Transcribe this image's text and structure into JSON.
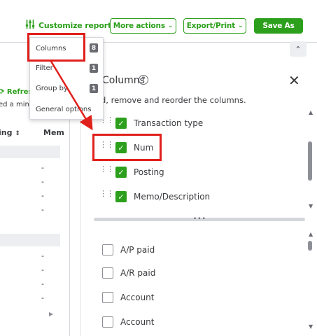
{
  "toolbar": {
    "customize_label": "Customize report",
    "more_actions_label": "More actions",
    "export_label": "Export/Print",
    "save_as_label": "Save As"
  },
  "report": {
    "refresh_label": "Refresh",
    "edited_text": "ed a min",
    "col1_header": "ing",
    "col2_header": "Mem",
    "dash": "-"
  },
  "menu": {
    "items": [
      {
        "label": "Columns",
        "badge": "8"
      },
      {
        "label": "Filter",
        "badge": "1"
      },
      {
        "label": "Group by",
        "badge": "1"
      },
      {
        "label": "General options",
        "badge": ""
      }
    ]
  },
  "panel": {
    "title": "Columns",
    "description": "d, remove and reorder the columns.",
    "selected_columns": [
      {
        "label": "Transaction type",
        "checked": true
      },
      {
        "label": "Num",
        "checked": true
      },
      {
        "label": "Posting",
        "checked": true
      },
      {
        "label": "Memo/Description",
        "checked": true
      }
    ],
    "available_columns": [
      {
        "label": "A/P paid",
        "checked": false
      },
      {
        "label": "A/R paid",
        "checked": false
      },
      {
        "label": "Account",
        "checked": false
      },
      {
        "label": "Account",
        "checked": false
      }
    ]
  },
  "colors": {
    "brand_green": "#2ca01c",
    "annotation_red": "#e0201b",
    "badge_gray": "#6b6c72"
  }
}
